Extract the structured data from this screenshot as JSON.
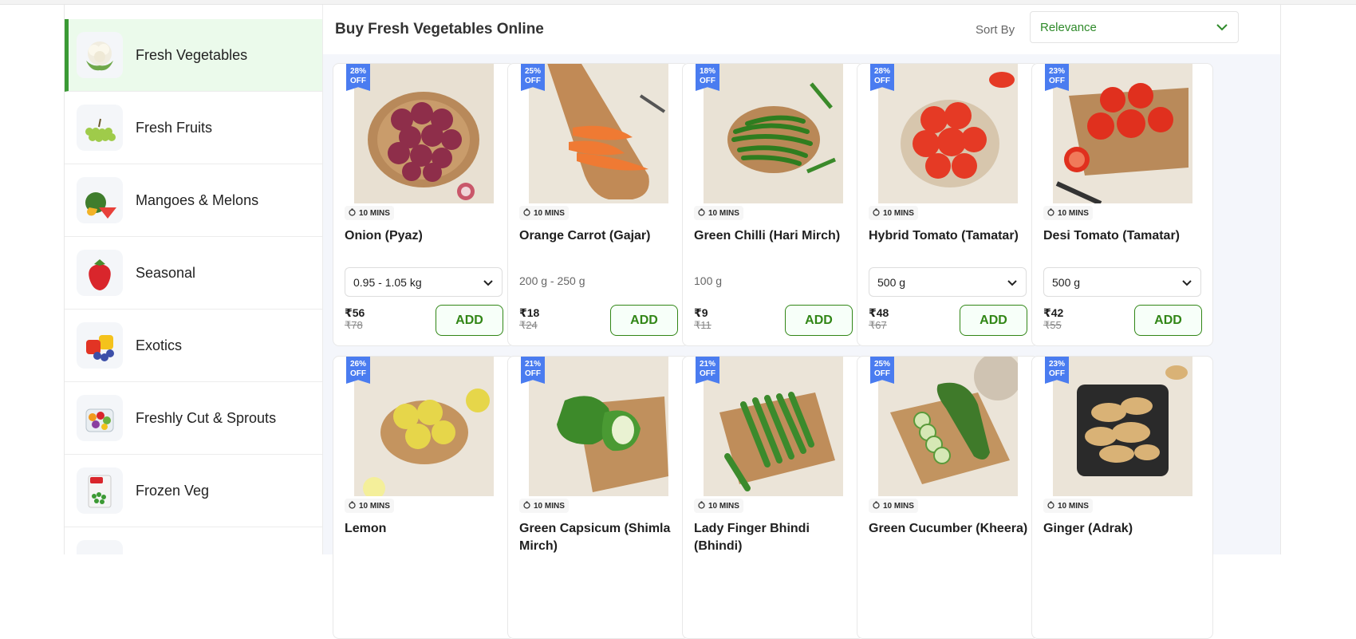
{
  "sidebar": {
    "items": [
      {
        "label": "Fresh Vegetables",
        "icon": "cauliflower-icon",
        "active": true
      },
      {
        "label": "Fresh Fruits",
        "icon": "grapes-icon"
      },
      {
        "label": "Mangoes & Melons",
        "icon": "watermelon-icon"
      },
      {
        "label": "Seasonal",
        "icon": "strawberry-icon"
      },
      {
        "label": "Exotics",
        "icon": "exotic-fruits-icon"
      },
      {
        "label": "Freshly Cut & Sprouts",
        "icon": "cut-fruit-icon"
      },
      {
        "label": "Frozen Veg",
        "icon": "frozen-peas-icon"
      },
      {
        "label": "",
        "icon": "category-icon"
      }
    ]
  },
  "header": {
    "title": "Buy Fresh Vegetables Online",
    "sort_label": "Sort By",
    "sort_value": "Relevance"
  },
  "colors": {
    "accent_green": "#318616",
    "badge_blue": "#4a7cf0",
    "active_bg": "#ebfaeb"
  },
  "products": [
    {
      "name": "Onion (Pyaz)",
      "discount": "28% OFF",
      "eta": "10 MINS",
      "variant": "0.95 - 1.05 kg",
      "has_dropdown": true,
      "price": "₹56",
      "mrp": "₹78",
      "add": "ADD",
      "image": "onion-image"
    },
    {
      "name": "Orange Carrot (Gajar)",
      "discount": "25% OFF",
      "eta": "10 MINS",
      "variant": "200 g - 250 g",
      "has_dropdown": false,
      "price": "₹18",
      "mrp": "₹24",
      "add": "ADD",
      "image": "carrot-image"
    },
    {
      "name": "Green Chilli (Hari Mirch)",
      "discount": "18% OFF",
      "eta": "10 MINS",
      "variant": "100 g",
      "has_dropdown": false,
      "price": "₹9",
      "mrp": "₹11",
      "add": "ADD",
      "image": "green-chilli-image"
    },
    {
      "name": "Hybrid Tomato (Tamatar)",
      "discount": "28% OFF",
      "eta": "10 MINS",
      "variant": "500 g",
      "has_dropdown": true,
      "price": "₹48",
      "mrp": "₹67",
      "add": "ADD",
      "image": "hybrid-tomato-image"
    },
    {
      "name": "Desi Tomato (Tamatar)",
      "discount": "23% OFF",
      "eta": "10 MINS",
      "variant": "500 g",
      "has_dropdown": true,
      "price": "₹42",
      "mrp": "₹55",
      "add": "ADD",
      "image": "desi-tomato-image"
    },
    {
      "name": "Lemon",
      "discount": "26% OFF",
      "eta": "10 MINS",
      "image": "lemon-image"
    },
    {
      "name": "Green Capsicum (Shimla Mirch)",
      "discount": "21% OFF",
      "eta": "10 MINS",
      "image": "capsicum-image"
    },
    {
      "name": "Lady Finger Bhindi (Bhindi)",
      "discount": "21% OFF",
      "eta": "10 MINS",
      "image": "lady-finger-image"
    },
    {
      "name": "Green Cucumber (Kheera)",
      "discount": "25% OFF",
      "eta": "10 MINS",
      "image": "cucumber-image"
    },
    {
      "name": "Ginger (Adrak)",
      "discount": "23% OFF",
      "eta": "10 MINS",
      "image": "ginger-image"
    }
  ]
}
